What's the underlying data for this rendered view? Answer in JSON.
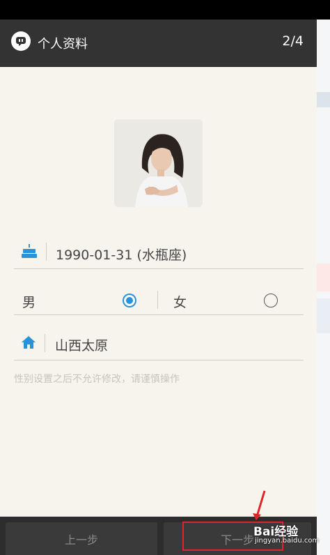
{
  "header": {
    "title": "个人资料",
    "step": "2/4"
  },
  "birthday": {
    "value": "1990-01-31 (水瓶座)"
  },
  "gender": {
    "male_label": "男",
    "female_label": "女",
    "selected": "男"
  },
  "region": {
    "value": "山西太原"
  },
  "hint": "性别设置之后不允许修改，请谨慎操作",
  "footer": {
    "prev_label": "上一步",
    "next_label": "下一步"
  },
  "watermark": {
    "brand": "Bai经验",
    "url": "jingyan.baidu.com"
  },
  "colors": {
    "accent": "#2a92d6",
    "header_bg": "#333333",
    "annotation": "#e0242a"
  },
  "icons": {
    "app": "chat-bubble-icon",
    "birthday": "cake-icon",
    "region": "home-icon"
  }
}
